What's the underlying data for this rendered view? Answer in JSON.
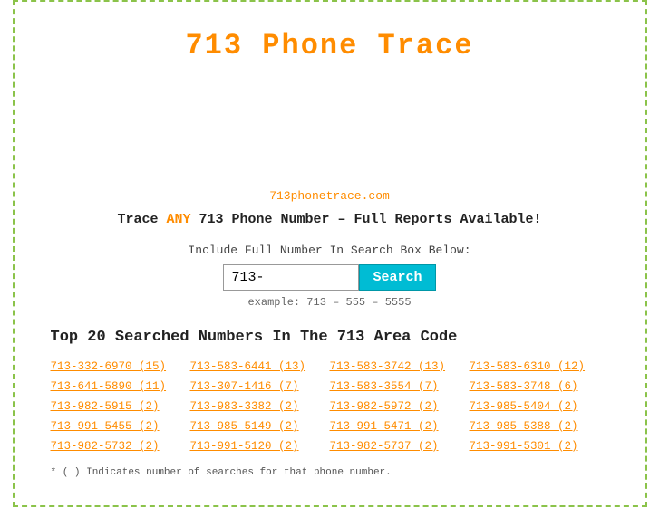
{
  "page": {
    "title": "713 Phone Trace",
    "site_url": "713phonetrace.com",
    "tagline_before": "Trace ",
    "tagline_any": "ANY",
    "tagline_after": " 713 Phone Number – Full Reports Available!",
    "search_label": "Include Full Number In Search Box Below:",
    "search_input_value": "713-",
    "search_button_label": "Search",
    "search_example": "example: 713 – 555 – 5555",
    "top_numbers_title": "Top 20 Searched Numbers In The 713 Area Code",
    "footnote": "* ( ) Indicates number of searches for that phone number."
  },
  "numbers": [
    {
      "label": "713-332-6970 (15)"
    },
    {
      "label": "713-583-6441 (13)"
    },
    {
      "label": "713-583-3742 (13)"
    },
    {
      "label": "713-583-6310 (12)"
    },
    {
      "label": "713-641-5890 (11)"
    },
    {
      "label": "713-307-1416 (7)"
    },
    {
      "label": "713-583-3554 (7)"
    },
    {
      "label": "713-583-3748 (6)"
    },
    {
      "label": "713-982-5915 (2)"
    },
    {
      "label": "713-983-3382 (2)"
    },
    {
      "label": "713-982-5972 (2)"
    },
    {
      "label": "713-985-5404 (2)"
    },
    {
      "label": "713-991-5455 (2)"
    },
    {
      "label": "713-985-5149 (2)"
    },
    {
      "label": "713-991-5471 (2)"
    },
    {
      "label": "713-985-5388 (2)"
    },
    {
      "label": "713-982-5732 (2)"
    },
    {
      "label": "713-991-5120 (2)"
    },
    {
      "label": "713-982-5737 (2)"
    },
    {
      "label": "713-991-5301 (2)"
    }
  ],
  "colors": {
    "orange": "#FF8C00",
    "teal": "#00BCD4",
    "border_green": "#8BC34A"
  }
}
